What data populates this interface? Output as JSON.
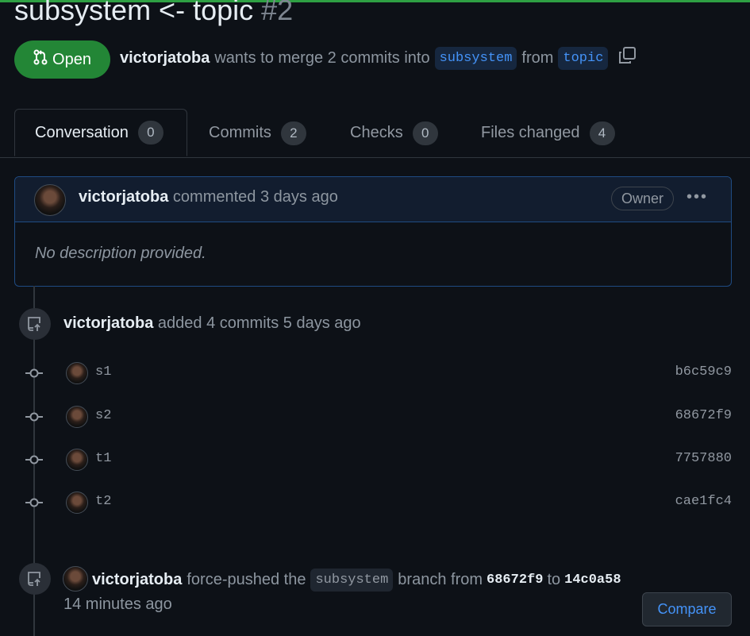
{
  "pr": {
    "title": "subsystem <- topic",
    "number": "#2",
    "state": "Open",
    "author": "victorjatoba",
    "merge_text": "wants to merge 2 commits into",
    "base_branch": "subsystem",
    "from_text": "from",
    "head_branch": "topic"
  },
  "tabs": [
    {
      "label": "Conversation",
      "count": "0"
    },
    {
      "label": "Commits",
      "count": "2"
    },
    {
      "label": "Checks",
      "count": "0"
    },
    {
      "label": "Files changed",
      "count": "4"
    }
  ],
  "comment": {
    "author": "victorjatoba",
    "action": "commented 3 days ago",
    "role": "Owner",
    "more": "•••",
    "body": "No description provided."
  },
  "commits_event": {
    "author": "victorjatoba",
    "text": "added 4 commits 5 days ago"
  },
  "commits": [
    {
      "message": "s1",
      "sha": "b6c59c9"
    },
    {
      "message": "s2",
      "sha": "68672f9"
    },
    {
      "message": "t1",
      "sha": "7757880"
    },
    {
      "message": "t2",
      "sha": "cae1fc4"
    }
  ],
  "push_event": {
    "author": "victorjatoba",
    "text1": "force-pushed the",
    "branch": "subsystem",
    "text2": "branch from",
    "from_sha": "68672f9",
    "text3": "to",
    "to_sha": "14c0a58",
    "time": "14 minutes ago",
    "compare_label": "Compare"
  },
  "colors": {
    "background": "#0d1117",
    "open_badge": "#238636",
    "link": "#4493f8",
    "comment_border": "#1f4b82"
  },
  "icons": [
    "git-pull-request-icon",
    "copy-icon",
    "kebab-horizontal-icon",
    "repo-push-icon",
    "git-commit-icon"
  ]
}
